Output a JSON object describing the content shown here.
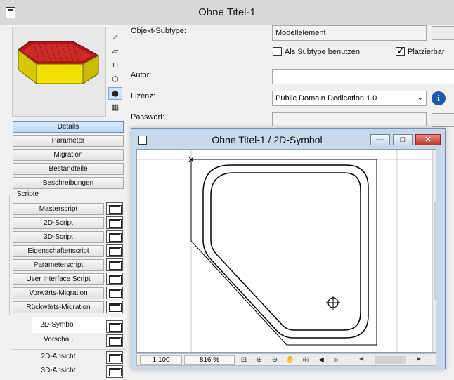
{
  "window": {
    "title": "Ohne Titel-1"
  },
  "preview": {
    "icon_names": [
      "axonometry-icon",
      "top-view-icon",
      "elevation-icon",
      "3d-box-icon",
      "3d-box-shaded-icon",
      "film-icon"
    ]
  },
  "nav": {
    "details": "Details",
    "parameter": "Parameter",
    "migration": "Migration",
    "bestandteile": "Bestandteile",
    "beschreibungen": "Beschreibungen"
  },
  "scripts": {
    "group_label": "Scripte",
    "items": [
      "Masterscript",
      "2D-Script",
      "3D-Script",
      "Eigenschaftenscript",
      "Parameterscript",
      "User Interface Script",
      "Vorwärts-Migration",
      "Rückwärts-Migration"
    ],
    "symbol_2d": "2D-Symbol",
    "vorschau": "Vorschau",
    "ansicht_2d": "2D-Ansicht",
    "ansicht_3d": "3D-Ansicht"
  },
  "form": {
    "subtype_label": "Objekt-Subtype:",
    "subtype_value": "Modellelement",
    "als_subtype": "Als Subtype benutzen",
    "als_subtype_checked": false,
    "platzierbar": "Platzierbar",
    "platzierbar_checked": true,
    "autor_label": "Autor:",
    "autor_value": "",
    "lizenz_label": "Lizenz:",
    "lizenz_value": "Public Domain Dedication 1.0",
    "passwort_label": "Passwort:"
  },
  "symbol_window": {
    "title": "Ohne Titel-1 / 2D-Symbol",
    "scale": "1:100",
    "zoom": "816 %"
  },
  "colors": {
    "accent": "#5f94c9",
    "preview_top": "#b01818",
    "preview_side": "#e3d400"
  }
}
